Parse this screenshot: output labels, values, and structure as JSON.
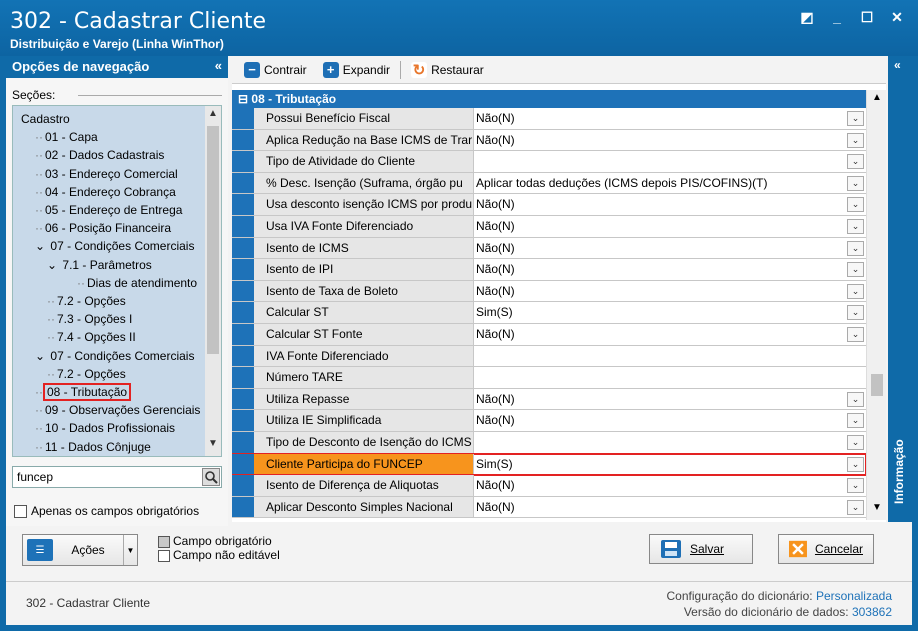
{
  "window": {
    "title": "302 - Cadastrar Cliente",
    "subtitle": "Distribuição e Varejo (Linha WinThor)",
    "controls": [
      "restore-icon",
      "minimize-icon",
      "maximize-icon",
      "close-icon"
    ]
  },
  "nav": {
    "header": "Opções de navegação",
    "collapse": "«",
    "sections_label": "Seções:",
    "items": [
      {
        "label": "Cadastro",
        "level": 0
      },
      {
        "label": "01 - Capa",
        "level": 1
      },
      {
        "label": "02 - Dados Cadastrais",
        "level": 1
      },
      {
        "label": "03 - Endereço Comercial",
        "level": 1
      },
      {
        "label": "04 - Endereço Cobrança",
        "level": 1
      },
      {
        "label": "05 - Endereço de Entrega",
        "level": 1
      },
      {
        "label": "06 - Posição Financeira",
        "level": 1
      },
      {
        "label": "07 - Condições Comerciais",
        "level": 1,
        "expanded": true
      },
      {
        "label": "7.1 - Parâmetros",
        "level": 2,
        "expanded": true
      },
      {
        "label": "Dias de atendimento",
        "level": 3
      },
      {
        "label": "7.2 - Opções",
        "level": 2
      },
      {
        "label": "7.3 - Opções I",
        "level": 2
      },
      {
        "label": "7.4 - Opções II",
        "level": 2
      },
      {
        "label": "07 - Condições Comerciais",
        "level": 1,
        "expanded": true
      },
      {
        "label": "7.2 - Opções",
        "level": 2
      },
      {
        "label": "08 - Tributação",
        "level": 1,
        "highlighted": true
      },
      {
        "label": "09 - Observações Gerenciais",
        "level": 1
      },
      {
        "label": "10 - Dados Profissionais",
        "level": 1
      },
      {
        "label": "11 - Dados Cônjuge",
        "level": 1
      }
    ],
    "search_value": "funcep",
    "required_only_label": "Apenas os campos obrigatórios"
  },
  "toolbar": {
    "contrair": "Contrair",
    "expandir": "Expandir",
    "restaurar": "Restaurar"
  },
  "grid": {
    "category": "08 - Tributação",
    "rows": [
      {
        "name": "Possui Benefício Fiscal",
        "value": "Não(N)",
        "dropdown": true
      },
      {
        "name": "Aplica Redução na Base ICMS de Trar",
        "value": "Não(N)",
        "dropdown": true
      },
      {
        "name": "Tipo de Atividade do Cliente",
        "value": "",
        "dropdown": true
      },
      {
        "name": "% Desc. Isenção (Suframa, órgão pu",
        "value": "Aplicar todas deduções (ICMS depois PIS/COFINS)(T)",
        "dropdown": true
      },
      {
        "name": "Usa desconto isenção ICMS por produ",
        "value": "Não(N)",
        "dropdown": true
      },
      {
        "name": "Usa IVA Fonte Diferenciado",
        "value": "Não(N)",
        "dropdown": true
      },
      {
        "name": "Isento de ICMS",
        "value": "Não(N)",
        "dropdown": true
      },
      {
        "name": "Isento de IPI",
        "value": "Não(N)",
        "dropdown": true
      },
      {
        "name": "Isento de Taxa de Boleto",
        "value": "Não(N)",
        "dropdown": true
      },
      {
        "name": "Calcular ST",
        "value": "Sim(S)",
        "dropdown": true
      },
      {
        "name": "Calcular ST Fonte",
        "value": "Não(N)",
        "dropdown": true
      },
      {
        "name": "IVA Fonte Diferenciado",
        "value": "",
        "dropdown": false
      },
      {
        "name": "Número TARE",
        "value": "",
        "dropdown": false
      },
      {
        "name": "Utiliza Repasse",
        "value": "Não(N)",
        "dropdown": true
      },
      {
        "name": "Utiliza IE Simplificada",
        "value": "Não(N)",
        "dropdown": true
      },
      {
        "name": "Tipo de Desconto de Isenção do ICMS",
        "value": "",
        "dropdown": true
      },
      {
        "name": "Cliente Participa do FUNCEP",
        "value": "Sim(S)",
        "dropdown": true,
        "selected": true
      },
      {
        "name": "Isento de Diferença de Aliquotas",
        "value": "Não(N)",
        "dropdown": true
      },
      {
        "name": "Aplicar Desconto Simples Nacional",
        "value": "Não(N)",
        "dropdown": true
      }
    ]
  },
  "info_side": {
    "toggle": "«",
    "label": "Informação"
  },
  "footer": {
    "acoes": "Ações",
    "legend_required": "Campo obrigatório",
    "legend_readonly": "Campo não editável",
    "salvar": "Salvar",
    "cancelar": "Cancelar"
  },
  "status": {
    "left": "302 - Cadastrar Cliente",
    "config_label": "Configuração do dicionário:",
    "config_value": "Personalizada",
    "version_label": "Versão do dicionário de dados:",
    "version_value": "303862"
  },
  "colors": {
    "title_bar": "#0f6aa8",
    "category_bar": "#1e72b8",
    "selected_row": "#f7941d",
    "highlight_border": "#e32222"
  }
}
